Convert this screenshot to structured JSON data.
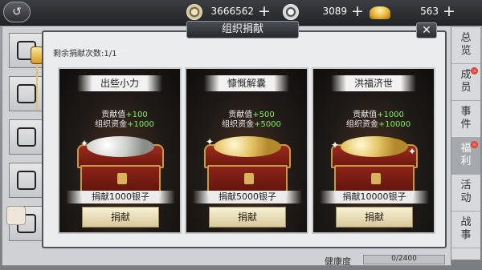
{
  "topbar": {
    "back_icon": "back-arrow-icon",
    "currencies": [
      {
        "name": "copper-coin",
        "icon": "copper-coin-icon",
        "value": "3666562",
        "plus": "+"
      },
      {
        "name": "silver-coin",
        "icon": "silver-coin-icon",
        "value": "3089",
        "plus": "+"
      },
      {
        "name": "gold-ingot",
        "icon": "gold-ingot-icon",
        "value": "563",
        "plus": "+"
      }
    ]
  },
  "dialog": {
    "title": "组织捐献",
    "close": "✕",
    "remaining": "剩余捐献次数:1/1",
    "cards": [
      {
        "title": "出些小力",
        "stat1_key": "贡献值",
        "stat1_val": "+100",
        "stat2_key": "组织资金",
        "stat2_val": "+1000",
        "note": "捐献1000银子",
        "button": "捐献",
        "coin": "silver"
      },
      {
        "title": "慷慨解囊",
        "stat1_key": "贡献值",
        "stat1_val": "+500",
        "stat2_key": "组织资金",
        "stat2_val": "+5000",
        "note": "捐献5000银子",
        "button": "捐献",
        "coin": "gold"
      },
      {
        "title": "洪福济世",
        "stat1_key": "贡献值",
        "stat1_val": "+1000",
        "stat2_key": "组织资金",
        "stat2_val": "+10000",
        "note": "捐献10000银子",
        "button": "捐献",
        "coin": "gold"
      }
    ]
  },
  "side_tabs": [
    {
      "label": "总览",
      "active": false,
      "dot": false
    },
    {
      "label": "成员",
      "active": false,
      "dot": true
    },
    {
      "label": "事件",
      "active": false,
      "dot": false
    },
    {
      "label": "福利",
      "active": true,
      "dot": true
    },
    {
      "label": "活动",
      "active": false,
      "dot": false
    },
    {
      "label": "战事",
      "active": false,
      "dot": false
    }
  ],
  "health": {
    "label": "健康度",
    "value": "0/2400",
    "progress": 0
  },
  "colors": {
    "bonus": "#7df05c",
    "active_tab": "#a5a8ad",
    "dot": "#c21b10"
  }
}
